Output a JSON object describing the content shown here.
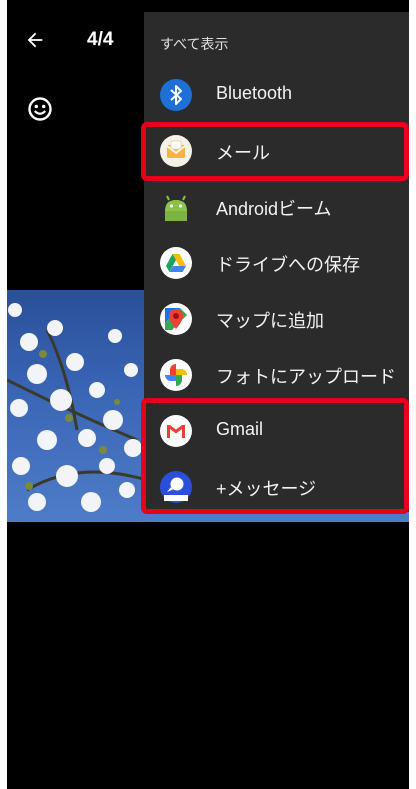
{
  "topbar": {
    "counter": "4/4"
  },
  "share_sheet": {
    "header": "すべて表示",
    "items": [
      {
        "label": "Bluetooth",
        "icon": "bluetooth-icon"
      },
      {
        "label": "メール",
        "icon": "mail-icon"
      },
      {
        "label": "Androidビーム",
        "icon": "android-beam-icon"
      },
      {
        "label": "ドライブへの保存",
        "icon": "google-drive-icon"
      },
      {
        "label": "マップに追加",
        "icon": "google-maps-icon"
      },
      {
        "label": "フォトにアップロード",
        "icon": "google-photos-icon"
      },
      {
        "label": "Gmail",
        "icon": "gmail-icon"
      },
      {
        "label": "+メッセージ",
        "icon": "plus-message-icon"
      }
    ]
  },
  "colors": {
    "highlight": "#e8001a",
    "sheet_bg": "#2b2b2b",
    "screen_bg": "#000000"
  }
}
